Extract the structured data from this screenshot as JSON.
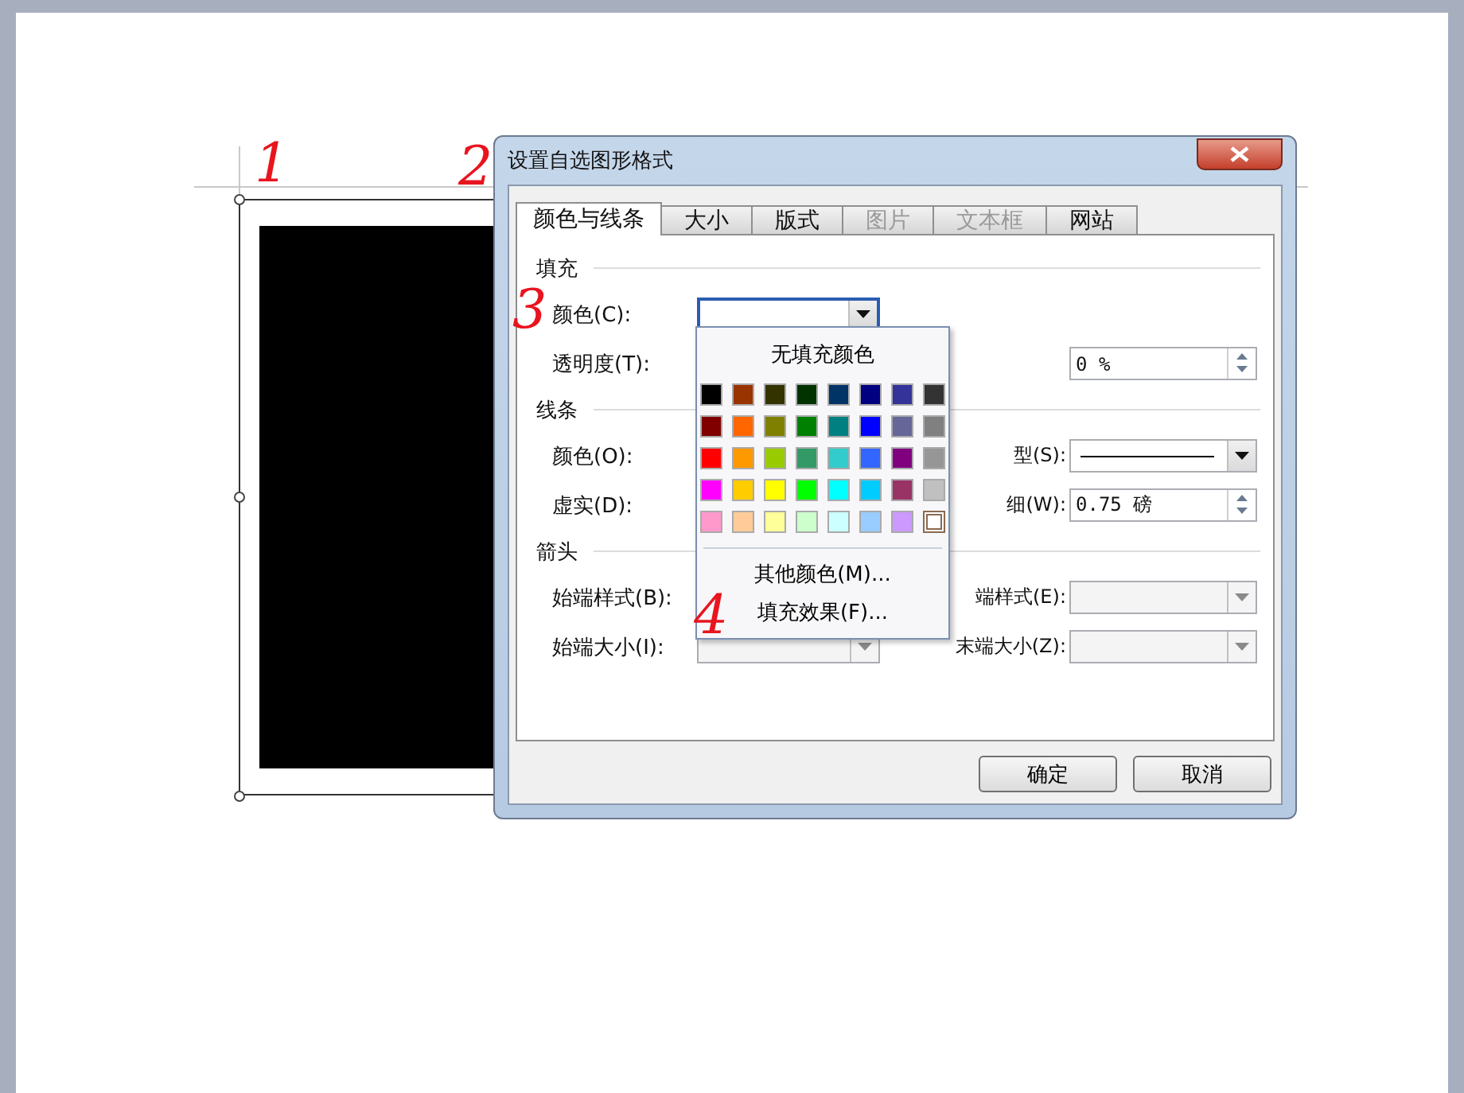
{
  "annotations": [
    "1",
    "2",
    "3",
    "4"
  ],
  "window": {
    "title": "设置自选图形格式"
  },
  "tabs": [
    {
      "label": "颜色与线条",
      "selected": true,
      "disabled": false
    },
    {
      "label": "大小",
      "selected": false,
      "disabled": false
    },
    {
      "label": "版式",
      "selected": false,
      "disabled": false
    },
    {
      "label": "图片",
      "selected": false,
      "disabled": true
    },
    {
      "label": "文本框",
      "selected": false,
      "disabled": true
    },
    {
      "label": "网站",
      "selected": false,
      "disabled": false
    }
  ],
  "panel": [
    {
      "kind": "heading",
      "label": "填充"
    },
    {
      "kind": "row",
      "label": "颜色(C):",
      "field": {
        "kind": "color"
      }
    },
    {
      "kind": "row",
      "label": "透明度(T):",
      "right_field": {
        "kind": "spin",
        "value": "0 %"
      }
    },
    {
      "kind": "heading",
      "label": "线条"
    },
    {
      "kind": "row",
      "label": "颜色(O):",
      "right_label": "型(S):",
      "right_field": {
        "kind": "line"
      }
    },
    {
      "kind": "row",
      "label": "虚实(D):",
      "right_label": "细(W):",
      "right_field": {
        "kind": "spin",
        "value": "0.75 磅"
      }
    },
    {
      "kind": "heading",
      "label": "箭头"
    },
    {
      "kind": "row",
      "label": "始端样式(B):",
      "right_label": "端样式(E):",
      "right_field": {
        "kind": "disabled"
      }
    },
    {
      "kind": "row",
      "label": "始端大小(I):",
      "field": {
        "kind": "disabled"
      },
      "right_label": "末端大小(Z):",
      "right_field": {
        "kind": "disabled"
      }
    }
  ],
  "color_menu": {
    "no_fill": "无填充颜色",
    "swatches": [
      {
        "color": "#000000",
        "selected": false
      },
      {
        "color": "#993300",
        "selected": false
      },
      {
        "color": "#333300",
        "selected": false
      },
      {
        "color": "#003300",
        "selected": false
      },
      {
        "color": "#003366",
        "selected": false
      },
      {
        "color": "#000080",
        "selected": false
      },
      {
        "color": "#333399",
        "selected": false
      },
      {
        "color": "#333333",
        "selected": false
      },
      {
        "color": "#800000",
        "selected": false
      },
      {
        "color": "#ff6600",
        "selected": false
      },
      {
        "color": "#808000",
        "selected": false
      },
      {
        "color": "#008000",
        "selected": false
      },
      {
        "color": "#008080",
        "selected": false
      },
      {
        "color": "#0000ff",
        "selected": false
      },
      {
        "color": "#666699",
        "selected": false
      },
      {
        "color": "#808080",
        "selected": false
      },
      {
        "color": "#ff0000",
        "selected": false
      },
      {
        "color": "#ff9900",
        "selected": false
      },
      {
        "color": "#99cc00",
        "selected": false
      },
      {
        "color": "#339966",
        "selected": false
      },
      {
        "color": "#33cccc",
        "selected": false
      },
      {
        "color": "#3366ff",
        "selected": false
      },
      {
        "color": "#800080",
        "selected": false
      },
      {
        "color": "#969696",
        "selected": false
      },
      {
        "color": "#ff00ff",
        "selected": false
      },
      {
        "color": "#ffcc00",
        "selected": false
      },
      {
        "color": "#ffff00",
        "selected": false
      },
      {
        "color": "#00ff00",
        "selected": false
      },
      {
        "color": "#00ffff",
        "selected": false
      },
      {
        "color": "#00ccff",
        "selected": false
      },
      {
        "color": "#993366",
        "selected": false
      },
      {
        "color": "#c0c0c0",
        "selected": false
      },
      {
        "color": "#ff99cc",
        "selected": false
      },
      {
        "color": "#ffcc99",
        "selected": false
      },
      {
        "color": "#ffff99",
        "selected": false
      },
      {
        "color": "#ccffcc",
        "selected": false
      },
      {
        "color": "#ccffff",
        "selected": false
      },
      {
        "color": "#99ccff",
        "selected": false
      },
      {
        "color": "#cc99ff",
        "selected": false
      },
      {
        "color": "#ffffff",
        "selected": true
      }
    ],
    "items": [
      "其他颜色(M)...",
      "填充效果(F)..."
    ]
  },
  "buttons": [
    "确定",
    "取消"
  ]
}
